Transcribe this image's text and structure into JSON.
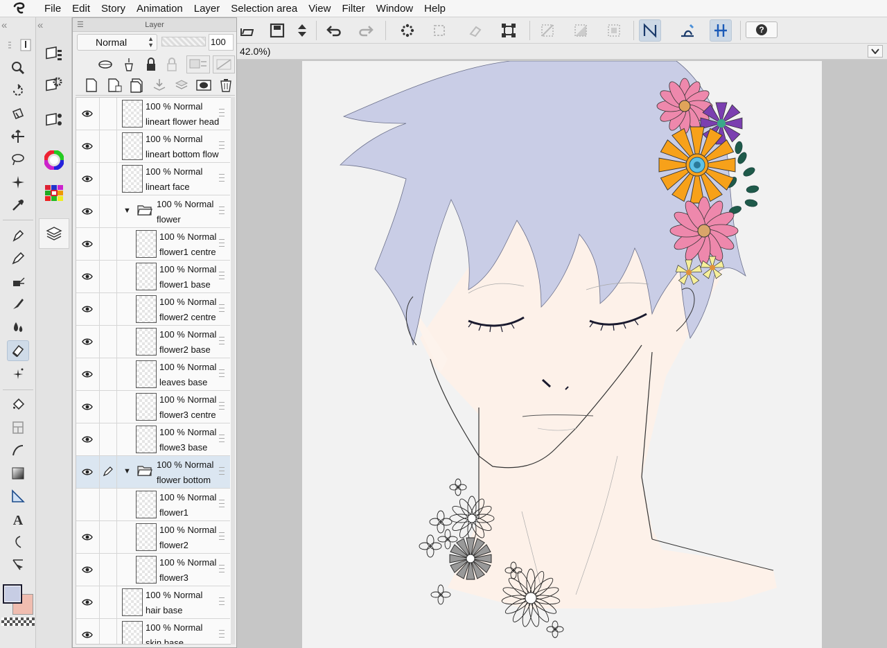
{
  "menu": [
    "File",
    "Edit",
    "Story",
    "Animation",
    "Layer",
    "Selection area",
    "View",
    "Filter",
    "Window",
    "Help"
  ],
  "canvas": {
    "zoom_label": "42.0%)"
  },
  "layer_panel": {
    "title": "Layer",
    "blend_mode": "Normal",
    "opacity": "100",
    "opacity_fraction": 1.0,
    "layers": [
      {
        "opacity_mode": "100 % Normal",
        "name": "lineart flower head",
        "indent": 0,
        "type": "layer",
        "visible": true
      },
      {
        "opacity_mode": "100 % Normal",
        "name": "lineart bottom flowers",
        "indent": 0,
        "type": "layer",
        "visible": true
      },
      {
        "opacity_mode": "100 % Normal",
        "name": "lineart face",
        "indent": 0,
        "type": "layer",
        "visible": true
      },
      {
        "opacity_mode": "100 % Normal",
        "name": "flower",
        "indent": 0,
        "type": "folder",
        "visible": true
      },
      {
        "opacity_mode": "100 % Normal",
        "name": "flower1 centre",
        "indent": 1,
        "type": "layer",
        "visible": true
      },
      {
        "opacity_mode": "100 % Normal",
        "name": "flower1 base",
        "indent": 1,
        "type": "layer",
        "visible": true
      },
      {
        "opacity_mode": "100 % Normal",
        "name": "flower2 centre",
        "indent": 1,
        "type": "layer",
        "visible": true
      },
      {
        "opacity_mode": "100 % Normal",
        "name": "flower2 base",
        "indent": 1,
        "type": "layer",
        "visible": true
      },
      {
        "opacity_mode": "100 % Normal",
        "name": "leaves base",
        "indent": 1,
        "type": "layer",
        "visible": true
      },
      {
        "opacity_mode": "100 % Normal",
        "name": "flower3 centre",
        "indent": 1,
        "type": "layer",
        "visible": true
      },
      {
        "opacity_mode": "100 % Normal",
        "name": "flowe3 base",
        "indent": 1,
        "type": "layer",
        "visible": true
      },
      {
        "opacity_mode": "100 % Normal",
        "name": "flower bottom",
        "indent": 0,
        "type": "folder",
        "visible": true,
        "selected": true
      },
      {
        "opacity_mode": "100 % Normal",
        "name": "flower1",
        "indent": 1,
        "type": "layer",
        "visible": false
      },
      {
        "opacity_mode": "100 % Normal",
        "name": "flower2",
        "indent": 1,
        "type": "layer",
        "visible": true
      },
      {
        "opacity_mode": "100 % Normal",
        "name": "flower3",
        "indent": 1,
        "type": "layer",
        "visible": true
      },
      {
        "opacity_mode": "100 % Normal",
        "name": "hair base",
        "indent": 0,
        "type": "layer",
        "visible": true
      },
      {
        "opacity_mode": "100 % Normal",
        "name": "skin base",
        "indent": 0,
        "type": "layer",
        "visible": true
      }
    ]
  },
  "colors": {
    "main_color": "#c7cde4",
    "sub_color": "#f0bdb0",
    "hair": "#c9cde6",
    "skin": "#fdf3ec",
    "selection_highlight": "#dbe6f1"
  },
  "icons": {
    "tools": [
      "zoom-icon",
      "rotate-icon",
      "object-icon",
      "move-layer-icon",
      "lasso-selection-icon",
      "auto-select-icon",
      "eyedropper-icon",
      "pen-icon",
      "pencil-icon",
      "airbrush-icon",
      "brush-icon",
      "blend-icon",
      "eraser-icon",
      "decoration-icon",
      "fill-icon",
      "frame-icon",
      "curve-icon",
      "gradient-icon",
      "ruler-icon",
      "text-icon",
      "balloon-icon",
      "correct-line-icon"
    ],
    "subtools": [
      "layer-property-icon",
      "subtool-settings-icon",
      "tool-property-icon",
      "color-wheel-icon",
      "color-set-icon",
      "layer-panel-icon"
    ]
  }
}
